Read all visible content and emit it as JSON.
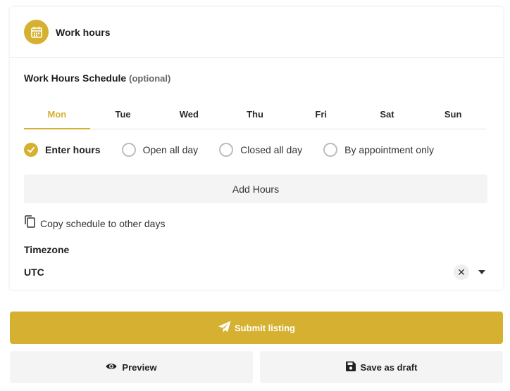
{
  "card": {
    "title": "Work hours",
    "icon": "calendar-icon"
  },
  "schedule": {
    "title": "Work Hours Schedule",
    "optional": "(optional)"
  },
  "tabs": [
    {
      "label": "Mon",
      "active": true
    },
    {
      "label": "Tue",
      "active": false
    },
    {
      "label": "Wed",
      "active": false
    },
    {
      "label": "Thu",
      "active": false
    },
    {
      "label": "Fri",
      "active": false
    },
    {
      "label": "Sat",
      "active": false
    },
    {
      "label": "Sun",
      "active": false
    }
  ],
  "options": [
    {
      "label": "Enter hours",
      "checked": true
    },
    {
      "label": "Open all day",
      "checked": false
    },
    {
      "label": "Closed all day",
      "checked": false
    },
    {
      "label": "By appointment only",
      "checked": false
    }
  ],
  "add_hours_label": "Add Hours",
  "copy_label": "Copy schedule to other days",
  "timezone": {
    "label": "Timezone",
    "value": "UTC",
    "clear_symbol": "✕"
  },
  "actions": {
    "submit_label": "Submit listing",
    "preview_label": "Preview",
    "draft_label": "Save as draft"
  },
  "colors": {
    "accent": "#d6b030",
    "button_bg": "#f4f4f4"
  }
}
